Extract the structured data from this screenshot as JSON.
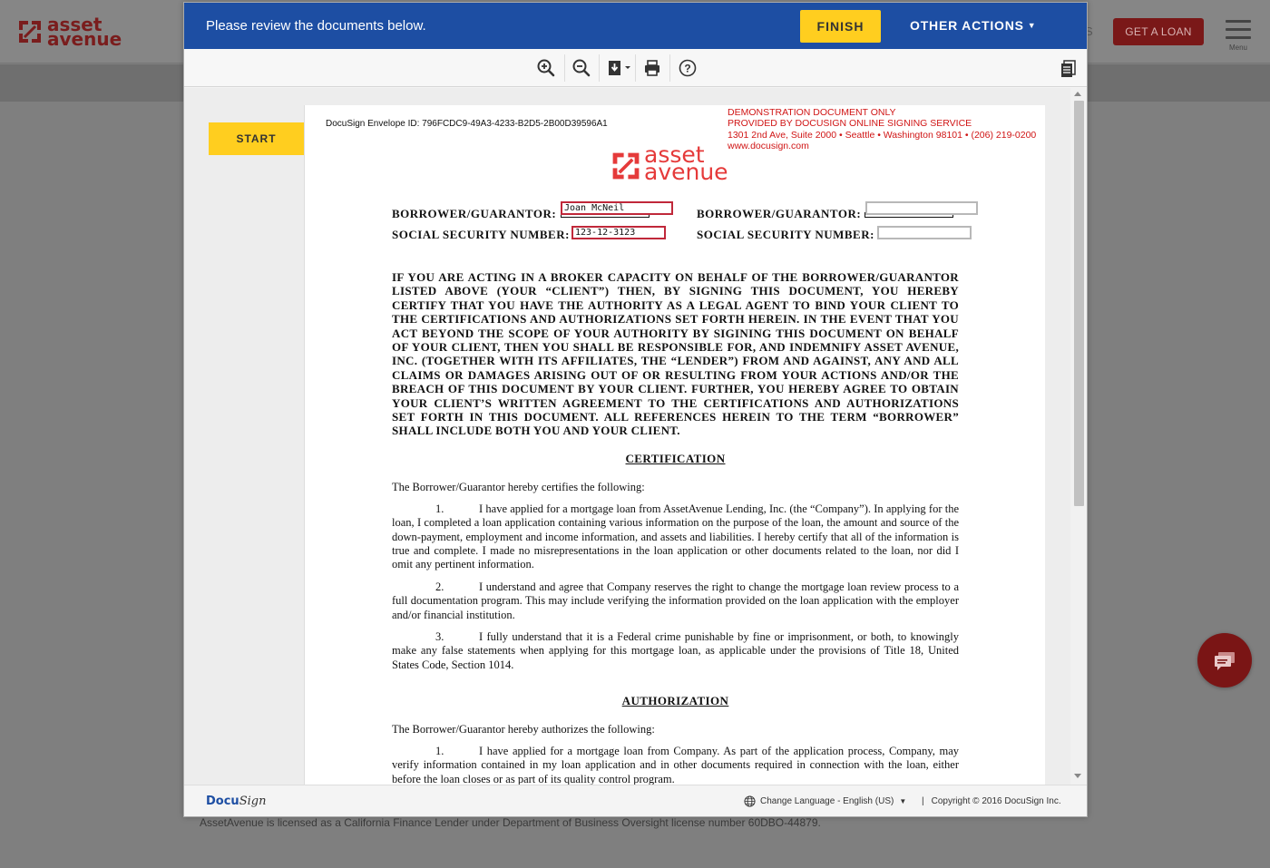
{
  "site": {
    "logo_top": "asset",
    "logo_bottom": "avenue",
    "nav_fragment": "S",
    "get_loan": "GET A LOAN",
    "menu_label": "Menu",
    "footer_text": "AssetAvenue is licensed as a California Finance Lender under Department of Business Oversight license number 60DBO-44879."
  },
  "docusign": {
    "header_message": "Please review the documents below.",
    "finish_label": "FINISH",
    "other_actions_label": "OTHER ACTIONS",
    "start_label": "START",
    "toolbar": {
      "icons": [
        "zoom-in-icon",
        "zoom-out-icon",
        "download-icon",
        "print-icon",
        "help-icon",
        "documents-list-icon"
      ]
    },
    "footer": {
      "logo_docu": "Docu",
      "logo_sign": "Sign",
      "language": "Change Language - English (US)",
      "copyright": "Copyright © 2016 DocuSign Inc."
    }
  },
  "document": {
    "envelope_id": "DocuSign Envelope ID: 796FCDC9-49A3-4233-B2D5-2B00D39596A1",
    "demo_lines": [
      "DEMONSTRATION DOCUMENT ONLY",
      "PROVIDED BY DOCUSIGN ONLINE SIGNING SERVICE",
      "1301 2nd Ave, Suite 2000  • Seattle • Washington 98101 • (206) 219-0200",
      "www.docusign.com"
    ],
    "logo_top": "asset",
    "logo_bottom": "avenue",
    "borrower_label": "BORROWER/GUARANTOR:",
    "ssn_label": "SOCIAL SECURITY NUMBER:",
    "borrower1_name": "Joan McNeil",
    "borrower1_ssn": "123-12-3123",
    "broker_paragraph": "IF YOU ARE ACTING IN A BROKER CAPACITY ON BEHALF OF THE BORROWER/GUARANTOR LISTED ABOVE (YOUR “CLIENT”) THEN, BY SIGNING THIS DOCUMENT, YOU HEREBY CERTIFY THAT YOU HAVE THE AUTHORITY AS A LEGAL AGENT TO BIND YOUR CLIENT TO THE CERTIFICATIONS AND AUTHORIZATIONS SET FORTH HEREIN. IN THE EVENT THAT YOU ACT BEYOND THE SCOPE OF YOUR AUTHORITY BY SIGINING THIS DOCUMENT ON BEHALF OF YOUR CLIENT, THEN YOU SHALL BE RESPONSIBLE FOR, AND INDEMNIFY ASSET AVENUE, INC. (TOGETHER WITH ITS AFFILIATES, THE “LENDER”) FROM AND AGAINST, ANY AND ALL CLAIMS OR DAMAGES ARISING OUT OF OR RESULTING FROM YOUR ACTIONS AND/OR THE BREACH OF THIS DOCUMENT BY YOUR CLIENT. FURTHER, YOU HEREBY AGREE TO OBTAIN YOUR CLIENT’S WRITTEN AGREEMENT TO THE CERTIFICATIONS AND AUTHORIZATIONS SET FORTH IN THIS DOCUMENT. ALL REFERENCES HEREIN TO THE TERM “BORROWER” SHALL INCLUDE BOTH YOU AND YOUR CLIENT.",
    "certification_heading": "CERTIFICATION",
    "certification_intro": "The Borrower/Guarantor hereby certifies the following:",
    "cert_items": [
      {
        "num": "1.",
        "text": "I have applied for a mortgage loan from AssetAvenue Lending, Inc. (the “Company”). In applying for the loan, I completed a loan application containing various information on the purpose of the loan, the amount and source of the down-payment, employment and income information, and assets and liabilities. I hereby certify that all of the information is true and complete. I made no misrepresentations in the loan application or other documents related to the loan, nor did I omit any pertinent information."
      },
      {
        "num": "2.",
        "text": "I understand and agree that Company reserves the right to change the mortgage loan review process to a full documentation program. This may include verifying the information provided on the loan application with the employer and/or financial institution."
      },
      {
        "num": "3.",
        "text": "I fully understand that it is a Federal crime punishable by fine or imprisonment, or both, to knowingly make any false statements when applying for this mortgage loan, as applicable under the provisions of Title 18, United States Code, Section 1014."
      }
    ],
    "authorization_heading": "AUTHORIZATION",
    "authorization_intro": "The Borrower/Guarantor hereby authorizes the following:",
    "auth_items": [
      {
        "num": "1.",
        "text": "I have applied for a mortgage loan from Company. As part of the application process, Company, may verify information contained in my loan application and in other documents required in connection with the loan, either before the loan closes or as part of its quality control program."
      }
    ]
  },
  "colors": {
    "docusign_blue": "#1d4ea3",
    "finish_yellow": "#ffce1f",
    "brand_red": "#e53a3a",
    "demo_red": "#d01515",
    "field_border": "#c0283a"
  }
}
